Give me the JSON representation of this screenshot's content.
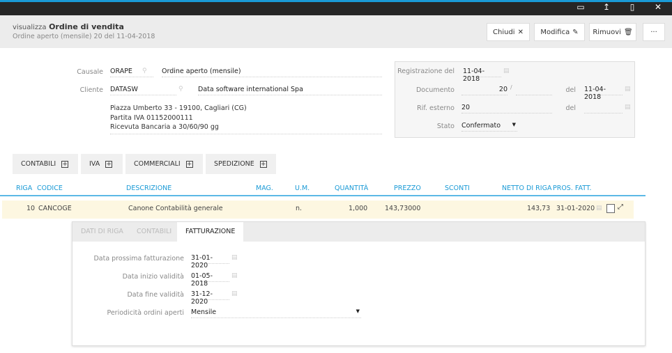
{
  "window": {
    "icons": [
      "window-icon",
      "upload-icon",
      "mobile-icon",
      "close-icon"
    ]
  },
  "header": {
    "prefix": "visualizza",
    "title": "Ordine di vendita",
    "subtitle": "Ordine aperto (mensile) 20 del 11-04-2018",
    "buttons": {
      "close": "Chiudi",
      "edit": "Modifica",
      "remove": "Rimuovi",
      "more": "···"
    }
  },
  "form": {
    "causale_label": "Causale",
    "causale_code": "ORAPE",
    "causale_desc": "Ordine aperto (mensile)",
    "cliente_label": "Cliente",
    "cliente_code": "DATASW",
    "cliente_desc": "Data software international Spa",
    "address": [
      "Piazza Umberto 33 - 19100, Cagliari (CG)",
      "Partita IVA 01152000111",
      "Ricevuta Bancaria a 30/60/90 gg"
    ]
  },
  "side": {
    "reg_label": "Registrazione del",
    "reg_date": "11-04-2018",
    "doc_label": "Documento",
    "doc_num": "20",
    "doc_sep": "/",
    "del_label": "del",
    "doc_date": "11-04-2018",
    "rif_label": "Rif. esterno",
    "rif_value": "20",
    "rif_del_label": "del",
    "stato_label": "Stato",
    "stato_value": "Confermato"
  },
  "tabs": [
    "CONTABILI",
    "IVA",
    "COMMERCIALI",
    "SPEDIZIONE"
  ],
  "table": {
    "headers": [
      "RIGA",
      "CODICE",
      "DESCRIZIONE",
      "MAG.",
      "U.M.",
      "QUANTITÀ",
      "PREZZO",
      "SCONTI",
      "NETTO DI RIGA",
      "PROS. FATT."
    ],
    "rows": [
      {
        "riga": "10",
        "codice": "CANCOGE",
        "descrizione": "Canone Contabilità generale",
        "um": "n.",
        "quantita": "1,000",
        "prezzo": "143,73000",
        "netto": "143,73",
        "pros": "31-01-2020"
      }
    ]
  },
  "detail": {
    "tabs": [
      "DATI DI RIGA",
      "CONTABILI",
      "FATTURAZIONE"
    ],
    "fields": [
      {
        "label": "Data prossima fatturazione",
        "value": "31-01-2020"
      },
      {
        "label": "Data inizio validità",
        "value": "01-05-2018"
      },
      {
        "label": "Data fine validità",
        "value": "31-12-2020"
      },
      {
        "label": "Periodicità ordini aperti",
        "value": "Mensile"
      }
    ]
  }
}
